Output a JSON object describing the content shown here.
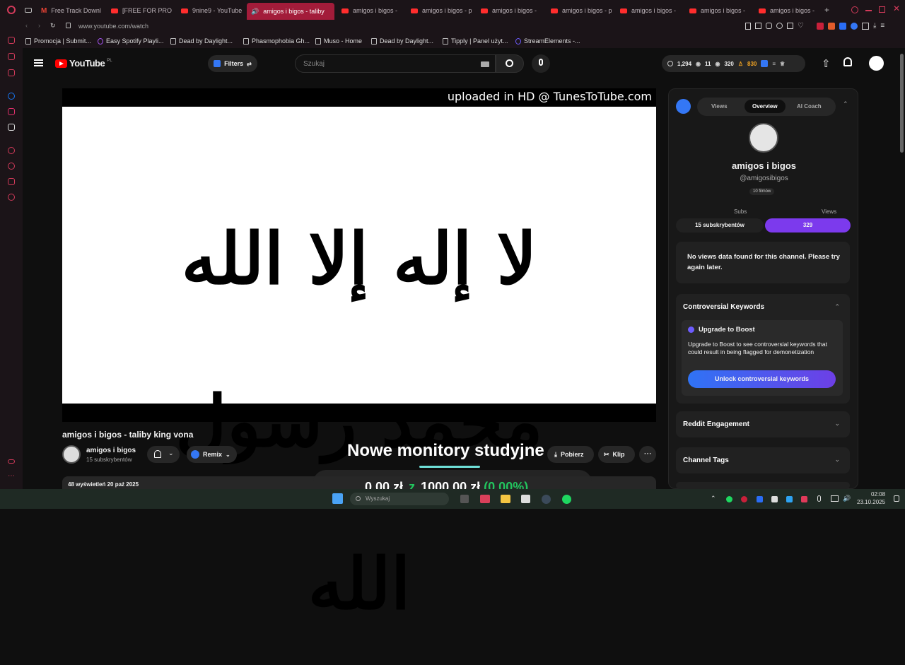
{
  "tabs": [
    {
      "label": "",
      "x": 0
    },
    {
      "label": "Free Track Downl",
      "x": 0
    },
    {
      "label": "[FREE FOR PROFI",
      "x": 0
    },
    {
      "label": "9nine9 - YouTube",
      "x": 0
    },
    {
      "label": "amigos i bigos - taliby",
      "x": 0
    },
    {
      "label": "amigos i bigos - ",
      "x": 0
    },
    {
      "label": "amigos i bigos - p",
      "x": 0
    },
    {
      "label": "amigos i bigos - ",
      "x": 0
    },
    {
      "label": "amigos i bigos - p",
      "x": 0
    },
    {
      "label": "amigos i bigos - ",
      "x": 0
    },
    {
      "label": "amigos i bigos - ",
      "x": 0
    },
    {
      "label": "amigos i bigos - ",
      "x": 0
    }
  ],
  "address": {
    "url": "www.youtube.com/watch"
  },
  "bookmarks": [
    "Promocja | Submit...",
    "Easy Spotify Playli...",
    "Dead by Daylight...",
    "Phasmophobia Gh...",
    "Muso - Home",
    "Dead by Daylight...",
    "Tipply | Panel użyt...",
    "StreamElements -..."
  ],
  "youtube": {
    "logo_text": "YouTube",
    "region": "PL",
    "filters_label": "Filters",
    "search_placeholder": "Szukaj",
    "stats": {
      "views": "1,294",
      "likes": "11",
      "eye": "320",
      "subs": "830"
    }
  },
  "video": {
    "watermark": "uploaded in HD @ TunesToTube.com",
    "calligraphy": "لا إله إلا الله محمد رسول الله",
    "title": "amigos i bigos - taliby king vona",
    "channel_name": "amigos i bigos",
    "channel_subs": "15 subskrybentów",
    "remix_label": "Remix",
    "download_label": "Pobierz",
    "clip_label": "Klip",
    "meta": "48 wyświetleń  20 paź 2025"
  },
  "overlay": {
    "title": "Nowe monitory studyjne",
    "money_current": "0,00 zł",
    "money_sep": "z",
    "money_goal": "1000,00 zł",
    "money_pct": "(0.00%)"
  },
  "panel": {
    "tabs": [
      "Views",
      "Overview",
      "AI Coach"
    ],
    "channel_name": "amigos i bigos",
    "handle": "@amigosibigos",
    "films": "10 filmów",
    "subs_label": "Subs",
    "views_label": "Views",
    "subs_value": "15 subskrybentów",
    "views_value": "329",
    "no_data_msg": "No views data found for this channel. Please try again later.",
    "controversial_title": "Controversial Keywords",
    "upgrade_title": "Upgrade to Boost",
    "upgrade_text": "Upgrade to Boost to see controversial keywords that could result in being flagged for demonetization",
    "unlock_button": "Unlock controversial keywords",
    "reddit_title": "Reddit Engagement",
    "channel_tags_title": "Channel Tags"
  },
  "taskbar": {
    "search_placeholder": "Wyszukaj",
    "time": "02:08",
    "date": "23.10.2025"
  },
  "colors": {
    "accent": "#7c3aed",
    "unlock": "#3b6cf6",
    "tab_active": "#a31c3a",
    "money_pct": "#22c55e"
  }
}
